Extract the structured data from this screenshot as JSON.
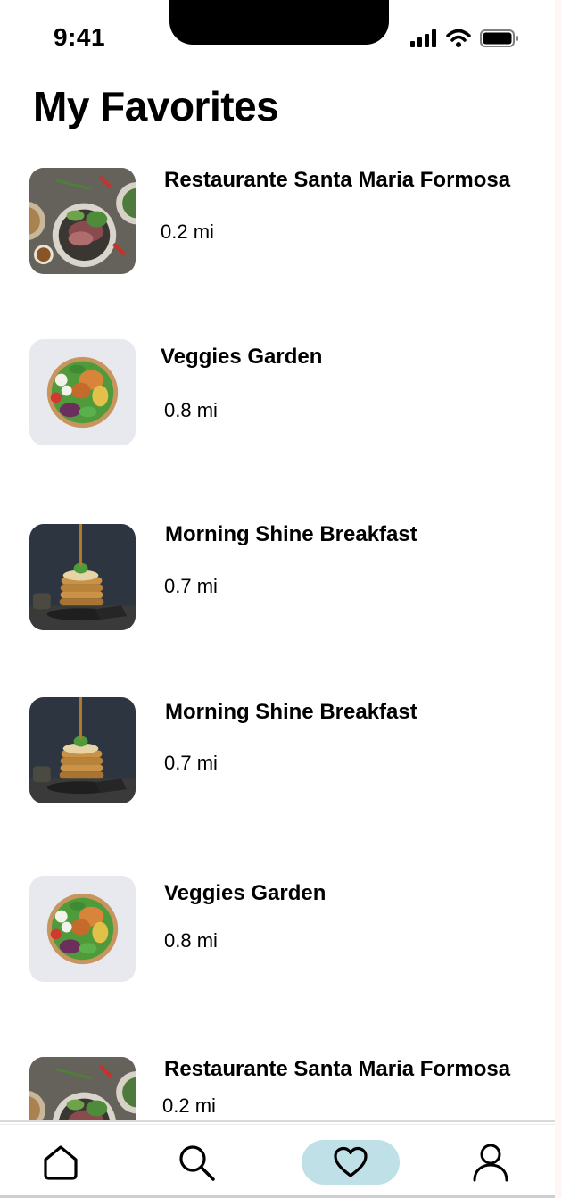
{
  "status_bar": {
    "time": "9:41",
    "icons": [
      "signal-icon",
      "wifi-icon",
      "battery-icon"
    ]
  },
  "page": {
    "title": "My Favorites"
  },
  "favorites": [
    {
      "name": "Restaurante Santa Maria Formosa",
      "distance": "0.2 mi",
      "thumb": "steak-plate"
    },
    {
      "name": "Veggies Garden",
      "distance": "0.8 mi",
      "thumb": "salad-bowl"
    },
    {
      "name": "Morning Shine Breakfast",
      "distance": "0.7 mi",
      "thumb": "pancake-stack"
    },
    {
      "name": "Morning Shine Breakfast",
      "distance": "0.7 mi",
      "thumb": "pancake-stack"
    },
    {
      "name": "Veggies Garden",
      "distance": "0.8 mi",
      "thumb": "salad-bowl"
    },
    {
      "name": "Restaurante Santa Maria Formosa",
      "distance": "0.2 mi",
      "thumb": "steak-plate"
    }
  ],
  "tab_bar": {
    "tabs": [
      {
        "id": "home",
        "icon": "home-icon"
      },
      {
        "id": "search",
        "icon": "search-icon"
      },
      {
        "id": "favorites",
        "icon": "heart-icon",
        "active": true
      },
      {
        "id": "profile",
        "icon": "user-icon"
      }
    ],
    "active_color": "#bfe0e6"
  }
}
